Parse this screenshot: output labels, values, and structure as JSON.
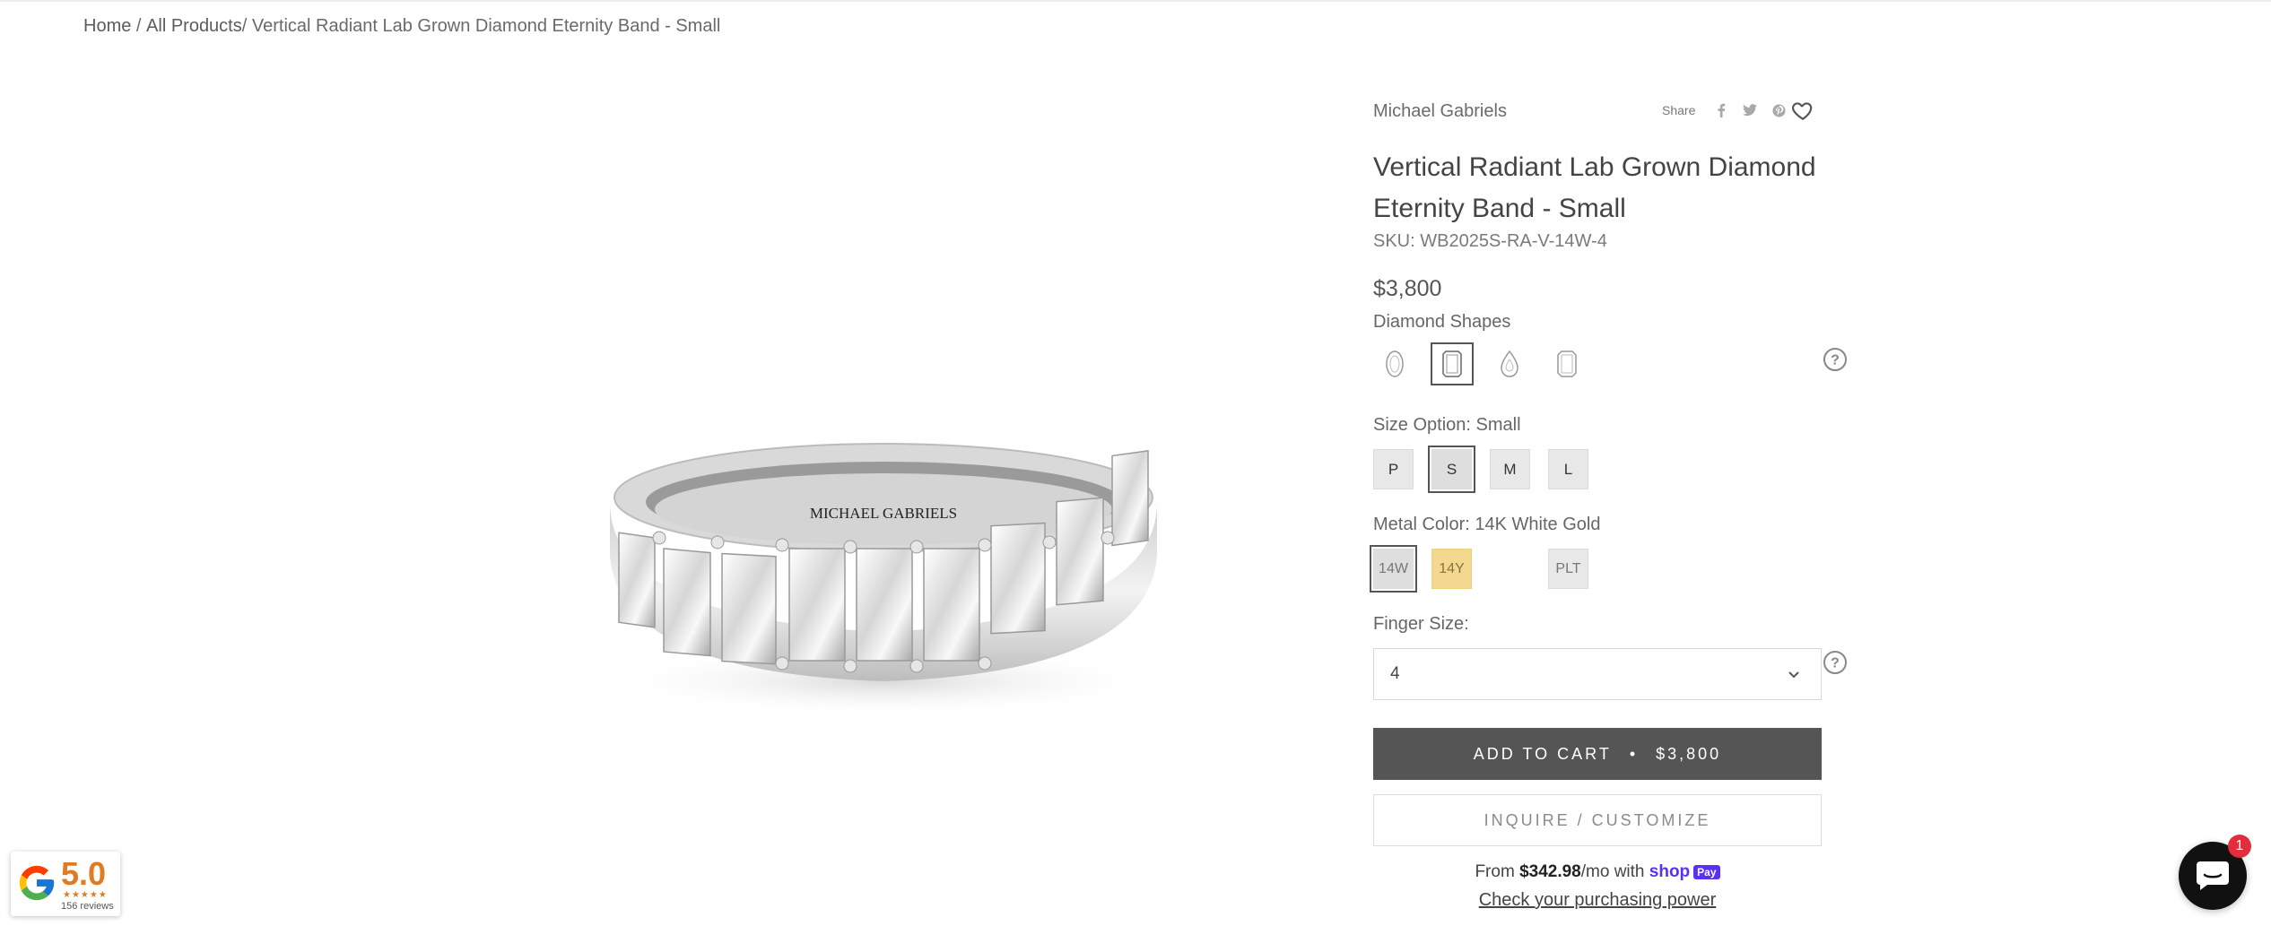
{
  "breadcrumb": {
    "home": "Home",
    "sep1": " / ",
    "all_products": "All Products",
    "sep2": "/ ",
    "current": "Vertical Radiant Lab Grown Diamond Eternity Band - Small"
  },
  "product": {
    "vendor": "Michael Gabriels",
    "share_label": "Share",
    "title": "Vertical Radiant Lab Grown Diamond Eternity Band - Small",
    "sku_label": "SKU:",
    "sku_value": "WB2025S-RA-V-14W-4",
    "price": "$3,800",
    "image_engraving": "MICHAEL GABRIELS"
  },
  "diamond_shapes": {
    "label": "Diamond Shapes",
    "options": [
      {
        "icon": "oval-shape-icon",
        "selected": false
      },
      {
        "icon": "radiant-shape-icon",
        "selected": true
      },
      {
        "icon": "pear-shape-icon",
        "selected": false
      },
      {
        "icon": "emerald-shape-icon",
        "selected": false
      }
    ]
  },
  "size_option": {
    "label": "Size Option:",
    "value": "Small",
    "options": [
      "P",
      "S",
      "M",
      "L"
    ],
    "selected": "S"
  },
  "metal_color": {
    "label": "Metal Color:",
    "value": "14K White Gold",
    "options": [
      "14W",
      "14Y",
      "",
      "PLT"
    ],
    "selected": "14W",
    "colors": {
      "14W": "#e8e8e8",
      "14Y": "#f2d98f",
      "PLT": "#e8e8e8"
    }
  },
  "finger_size": {
    "label": "Finger Size:",
    "value": "4"
  },
  "cart": {
    "add_label": "ADD TO CART",
    "separator": "•",
    "price": "$3,800",
    "inquire_label": "INQUIRE / CUSTOMIZE"
  },
  "financing": {
    "from": "From",
    "amount": "$342.98",
    "per": "/mo with",
    "brand": "shop",
    "brand_pay": "Pay",
    "check": "Check your purchasing power"
  },
  "google_badge": {
    "score": "5.0",
    "stars": "★★★★★",
    "reviews": "156 reviews"
  },
  "chat": {
    "badge_count": "1"
  },
  "colors": {
    "button_dark": "#555555",
    "shop_pay": "#5a31f4",
    "chat_badge": "#e22d3c",
    "google_score": "#e07b1f"
  }
}
